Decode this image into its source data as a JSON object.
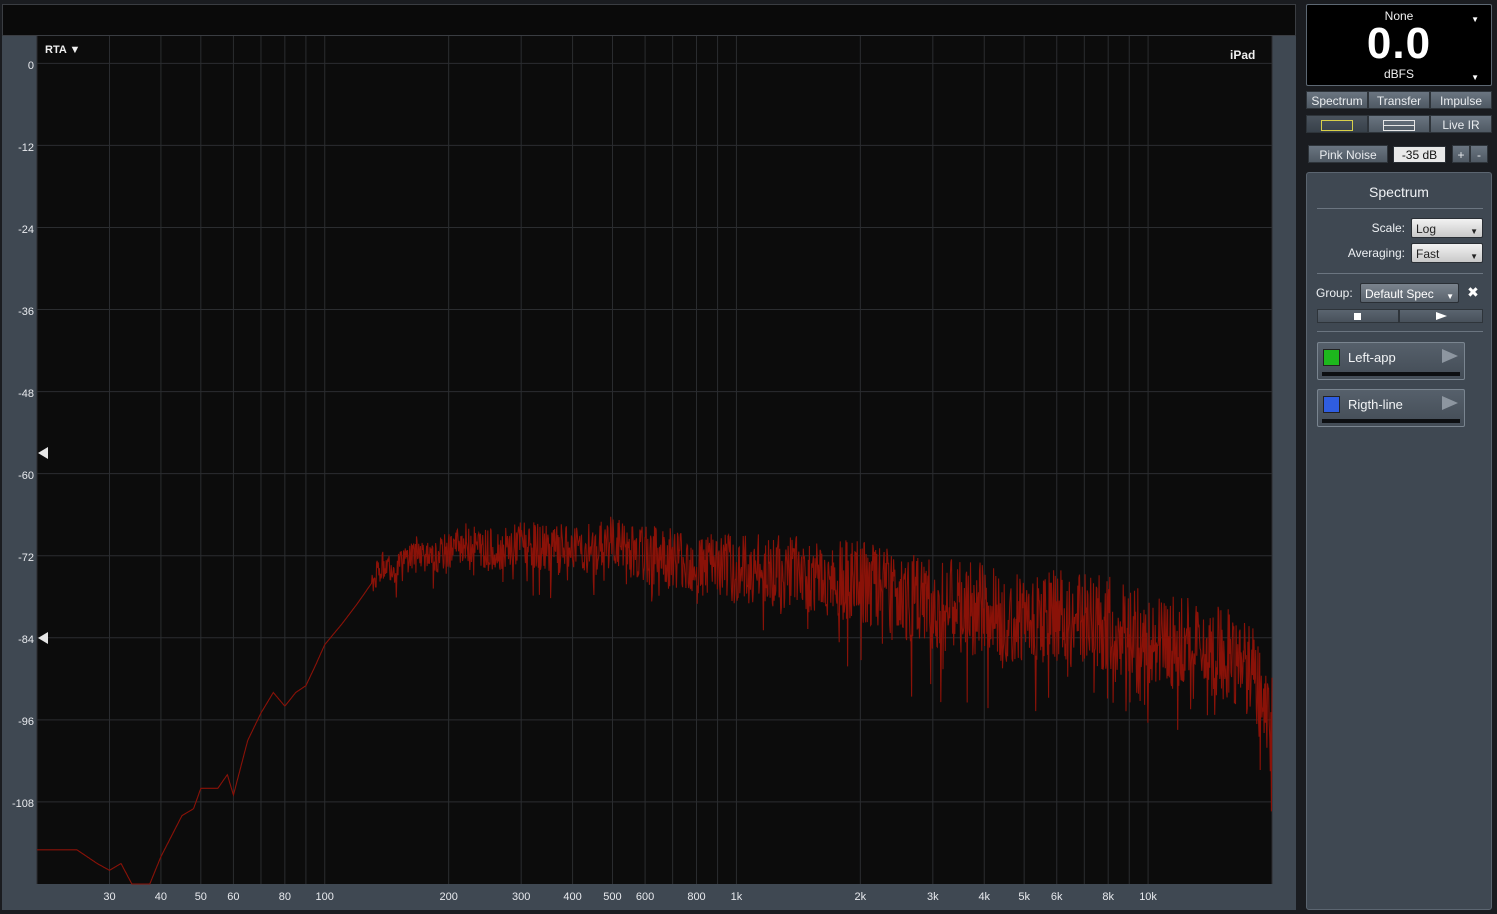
{
  "plot": {
    "mode_menu": "RTA ▼",
    "device": "iPad",
    "y_ticks": [
      "0",
      "-12",
      "-24",
      "-36",
      "-48",
      "-60",
      "-72",
      "-84",
      "-96",
      "-108"
    ],
    "x_ticks": [
      "30",
      "40",
      "50",
      "60",
      "80",
      "100",
      "200",
      "300",
      "400",
      "500",
      "600",
      "800",
      "1k",
      "2k",
      "3k",
      "4k",
      "5k",
      "6k",
      "8k",
      "10k"
    ],
    "trace_color": "#8a1208",
    "background": "#0c0c0c",
    "grid_color": "#2b2d30",
    "markers": [
      -57,
      -84
    ]
  },
  "chart_data": {
    "type": "line",
    "x_scale": "log",
    "xlim": [
      20,
      20000
    ],
    "ylim": [
      -120,
      4
    ],
    "grid": true,
    "series": [
      {
        "x": [
          20,
          25,
          28,
          30,
          32,
          34,
          37,
          40,
          45,
          48,
          50,
          55,
          58,
          60,
          65,
          70,
          75,
          80,
          85,
          90,
          95,
          100,
          110,
          120,
          130,
          140,
          150,
          160,
          170,
          180,
          200,
          220,
          250,
          280,
          300,
          350,
          400,
          450,
          500,
          600,
          700,
          800,
          1000,
          1200,
          1500,
          2000,
          2500,
          3000,
          4000,
          5000,
          6000,
          8000,
          10000,
          12000,
          15000,
          17000,
          18000,
          20000
        ],
        "y": [
          -115,
          -115,
          -117,
          -118,
          -117,
          -120,
          -121,
          -116,
          -110,
          -109,
          -106,
          -106,
          -104,
          -107,
          -99,
          -95,
          -92,
          -94,
          -92,
          -91,
          -88,
          -85,
          -82,
          -79,
          -76,
          -73,
          -74,
          -72,
          -71,
          -73,
          -71,
          -70,
          -71,
          -71,
          -70,
          -71,
          -71,
          -71,
          -70,
          -72,
          -72,
          -73,
          -74,
          -74,
          -75,
          -76,
          -78,
          -79,
          -80,
          -81,
          -81,
          -82,
          -84,
          -85,
          -86,
          -88,
          -88,
          -96
        ]
      }
    ]
  },
  "meter": {
    "source": "None",
    "value": "0.0",
    "unit": "dBFS"
  },
  "tabs": [
    "Spectrum",
    "Transfer",
    "Impulse"
  ],
  "layout_buttons": {
    "live_ir": "Live IR"
  },
  "generator": {
    "signal": "Pink Noise",
    "level": "-35 dB",
    "plus": "+",
    "minus": "-"
  },
  "panel": {
    "title": "Spectrum",
    "scale_label": "Scale:",
    "scale_value": "Log",
    "averaging_label": "Averaging:",
    "averaging_value": "Fast",
    "group_label": "Group:",
    "group_value": "Default Spec"
  },
  "traces": [
    {
      "name": "Left-app",
      "color": "#1db81d"
    },
    {
      "name": "Rigth-line",
      "color": "#2f5de0"
    }
  ]
}
